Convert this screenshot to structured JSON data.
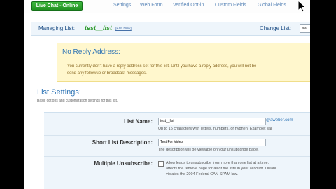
{
  "topbar": {
    "live_chat": "Live Chat - Online",
    "links": [
      "Settings",
      "Web Form",
      "Verified Opt-in",
      "Custom Fields",
      "Global Fields"
    ]
  },
  "manage": {
    "label": "Managing List:",
    "list_name": "test__list",
    "edit_link": "[Edit Now]",
    "change_label": "Change List:",
    "change_value": "test__lis"
  },
  "notice": {
    "title": "No Reply Address:",
    "line1": "You currently don't have a reply address set for this list. Until you have a reply address, you will not be",
    "line2": "send any followup or broadcast messages."
  },
  "settings": {
    "title": "List Settings:",
    "subtitle": "Basic options and customization settings for this list.",
    "list_name": {
      "label": "List Name:",
      "value": "test__list",
      "suffix": "@aweber.com",
      "help": "Up to 15 characters with letters, numbers, or hyphen. Example: sal"
    },
    "short_desc": {
      "label": "Short List Description:",
      "value": "Test For Video",
      "help": "The description will be viewable on your unsubscribe page."
    },
    "multi_unsub": {
      "label": "Multiple Unsubscribe:",
      "line1": "Allow leads to unsubscribe from more than one list at a time.",
      "line2": "affects the remove page for all of the lists in your account. Disabl",
      "line3": "violates the 2004 Federal CAN-SPAM law."
    }
  },
  "colors": {
    "accent_blue": "#2e74b5",
    "live_green": "#2a9d2a",
    "notice_bg": "#fff7cd"
  }
}
